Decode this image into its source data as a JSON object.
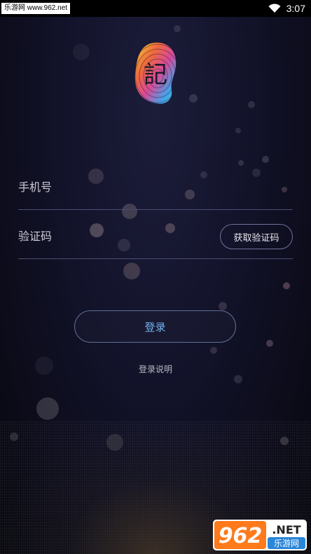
{
  "status_bar": {
    "site_label": "乐游网 www.962.net",
    "time": "3:07"
  },
  "logo": {
    "glyph": "記"
  },
  "form": {
    "phone_placeholder": "手机号",
    "code_placeholder": "验证码",
    "get_code_label": "获取验证码"
  },
  "actions": {
    "login_label": "登录",
    "login_help_label": "登录说明"
  },
  "watermark": {
    "brand": "962",
    "suffix": ".NET",
    "caption": "乐游网"
  },
  "colors": {
    "accent_blue": "#6fb3ef",
    "background": "#121229",
    "divider": "#4a4d73"
  }
}
